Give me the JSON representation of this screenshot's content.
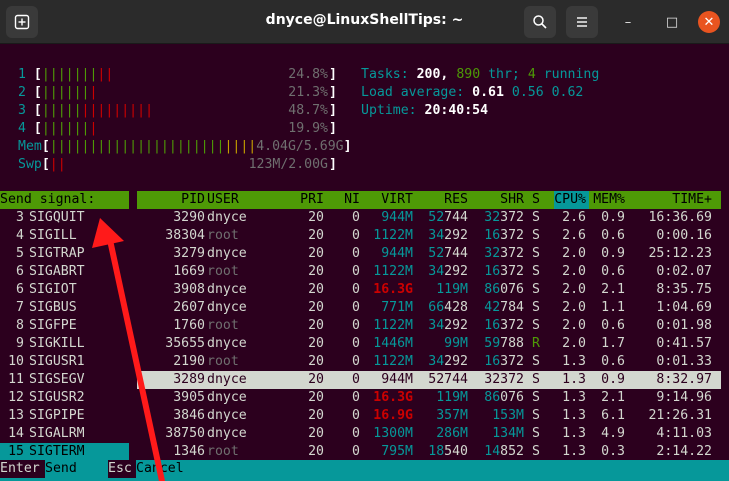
{
  "window": {
    "title": "dnyce@LinuxShellTips: ~",
    "new_tab_icon": "new-tab-icon",
    "search_icon": "search-icon",
    "menu_icon": "hamburger-menu-icon",
    "minimize_glyph": "–",
    "maximize_glyph": "□",
    "close_glyph": "✕"
  },
  "meters": {
    "cpus": [
      {
        "label": "1",
        "bars_green": "|||||||",
        "bars_red": "||",
        "pct": "24.8%"
      },
      {
        "label": "2",
        "bars_green": "||||||",
        "bars_red": "|",
        "pct": "21.3%"
      },
      {
        "label": "3",
        "bars_green": "|||||",
        "bars_red": "|||||||||",
        "pct": "48.7%"
      },
      {
        "label": "4",
        "bars_green": "||||||",
        "bars_red": "|",
        "pct": "19.9%"
      }
    ],
    "mem": {
      "label": "Mem",
      "bars_green": "||||||||||||||||||||||",
      "bars_yellow": "||||",
      "used": "4.04G",
      "sep": "/",
      "total": "5.69G"
    },
    "swp": {
      "label": "Swp",
      "bars_red": "||",
      "value": "123M/2.00G"
    }
  },
  "summary": {
    "tasks_label": "Tasks:",
    "tasks": "200,",
    "thr": "890",
    "thr_label": "thr;",
    "running": "4",
    "running_label": "running",
    "load_label": "Load average:",
    "load1": "0.61",
    "load5": "0.56",
    "load15": "0.62",
    "uptime_label": "Uptime:",
    "uptime": "20:40:54"
  },
  "signal_panel": {
    "header": "Send signal:",
    "items": [
      {
        "num": "3",
        "name": "SIGQUIT"
      },
      {
        "num": "4",
        "name": "SIGILL"
      },
      {
        "num": "5",
        "name": "SIGTRAP"
      },
      {
        "num": "6",
        "name": "SIGABRT"
      },
      {
        "num": "6",
        "name": "SIGIOT"
      },
      {
        "num": "7",
        "name": "SIGBUS"
      },
      {
        "num": "8",
        "name": "SIGFPE"
      },
      {
        "num": "9",
        "name": "SIGKILL"
      },
      {
        "num": "10",
        "name": "SIGUSR1"
      },
      {
        "num": "11",
        "name": "SIGSEGV"
      },
      {
        "num": "12",
        "name": "SIGUSR2"
      },
      {
        "num": "13",
        "name": "SIGPIPE"
      },
      {
        "num": "14",
        "name": "SIGALRM"
      },
      {
        "num": "15",
        "name": "SIGTERM"
      }
    ]
  },
  "process_table": {
    "columns": {
      "pid": "PID",
      "user": "USER",
      "pri": "PRI",
      "ni": "NI",
      "virt": "VIRT",
      "res": "RES",
      "shr": "SHR",
      "s": "S",
      "cpu": "CPU%",
      "mem": "MEM%",
      "time": "TIME+"
    },
    "rows": [
      {
        "pid": "3290",
        "user": "dnyce",
        "pri": "20",
        "ni": "0",
        "virt": "944M",
        "res_a": "52",
        "res_b": "744",
        "shr_a": "32",
        "shr_b": "372",
        "s": "S",
        "cpu": "2.6",
        "mem": "0.9",
        "time": "16:36.69"
      },
      {
        "pid": "38304",
        "user": "root",
        "pri": "20",
        "ni": "0",
        "virt": "1122M",
        "res_a": "34",
        "res_b": "292",
        "shr_a": "16",
        "shr_b": "372",
        "s": "S",
        "cpu": "2.6",
        "mem": "0.6",
        "time": "0:00.16"
      },
      {
        "pid": "3279",
        "user": "dnyce",
        "pri": "20",
        "ni": "0",
        "virt": "944M",
        "res_a": "52",
        "res_b": "744",
        "shr_a": "32",
        "shr_b": "372",
        "s": "S",
        "cpu": "2.0",
        "mem": "0.9",
        "time": "25:12.23"
      },
      {
        "pid": "1669",
        "user": "root",
        "pri": "20",
        "ni": "0",
        "virt": "1122M",
        "res_a": "34",
        "res_b": "292",
        "shr_a": "16",
        "shr_b": "372",
        "s": "S",
        "cpu": "2.0",
        "mem": "0.6",
        "time": "0:02.07"
      },
      {
        "pid": "3908",
        "user": "dnyce",
        "pri": "20",
        "ni": "0",
        "virt": "16.3G",
        "virt_red": true,
        "res": "119M",
        "shr_a": "86",
        "shr_b": "076",
        "s": "S",
        "cpu": "2.0",
        "mem": "2.1",
        "time": "8:35.75"
      },
      {
        "pid": "2607",
        "user": "dnyce",
        "pri": "20",
        "ni": "0",
        "virt": "771M",
        "res_a": "66",
        "res_b": "428",
        "shr_a": "42",
        "shr_b": "784",
        "s": "S",
        "cpu": "2.0",
        "mem": "1.1",
        "time": "1:04.69"
      },
      {
        "pid": "1760",
        "user": "root",
        "pri": "20",
        "ni": "0",
        "virt": "1122M",
        "res_a": "34",
        "res_b": "292",
        "shr_a": "16",
        "shr_b": "372",
        "s": "S",
        "cpu": "2.0",
        "mem": "0.6",
        "time": "0:01.98"
      },
      {
        "pid": "35655",
        "user": "dnyce",
        "pri": "20",
        "ni": "0",
        "virt": "1446M",
        "res": "99M",
        "shr_a": "59",
        "shr_b": "788",
        "s": "R",
        "cpu": "2.0",
        "mem": "1.7",
        "time": "0:41.57"
      },
      {
        "pid": "2190",
        "user": "root",
        "pri": "20",
        "ni": "0",
        "virt": "1122M",
        "res_a": "34",
        "res_b": "292",
        "shr_a": "16",
        "shr_b": "372",
        "s": "S",
        "cpu": "1.3",
        "mem": "0.6",
        "time": "0:01.33"
      },
      {
        "pid": "3289",
        "user": "dnyce",
        "pri": "20",
        "ni": "0",
        "virt": "944M",
        "res_a": "52",
        "res_b": "744",
        "shr_a": "32",
        "shr_b": "372",
        "s": "S",
        "cpu": "1.3",
        "mem": "0.9",
        "time": "8:32.97"
      },
      {
        "pid": "3905",
        "user": "dnyce",
        "pri": "20",
        "ni": "0",
        "virt": "16.3G",
        "virt_red": true,
        "res": "119M",
        "shr_a": "86",
        "shr_b": "076",
        "s": "S",
        "cpu": "1.3",
        "mem": "2.1",
        "time": "9:14.96"
      },
      {
        "pid": "3846",
        "user": "dnyce",
        "pri": "20",
        "ni": "0",
        "virt": "16.9G",
        "virt_red": true,
        "res": "357M",
        "shr": "153M",
        "s": "S",
        "cpu": "1.3",
        "mem": "6.1",
        "time": "21:26.31"
      },
      {
        "pid": "38750",
        "user": "dnyce",
        "pri": "20",
        "ni": "0",
        "virt": "1300M",
        "res": "286M",
        "shr": "134M",
        "s": "S",
        "cpu": "1.3",
        "mem": "4.9",
        "time": "4:11.03"
      },
      {
        "pid": "1346",
        "user": "root",
        "pri": "20",
        "ni": "0",
        "virt": "795M",
        "res_a": "18",
        "res_b": "540",
        "shr_a": "14",
        "shr_b": "852",
        "s": "S",
        "cpu": "1.3",
        "mem": "0.3",
        "time": "2:14.22"
      }
    ]
  },
  "footer": {
    "key1": "Enter",
    "label1": "Send",
    "key2": "Esc",
    "label2": "Cancel"
  },
  "colors": {
    "terminal_bg": "#2c001e",
    "header_green": "#4e9a06",
    "highlight_cyan": "#06989a",
    "annotation_arrow": "#ff1a1a"
  }
}
